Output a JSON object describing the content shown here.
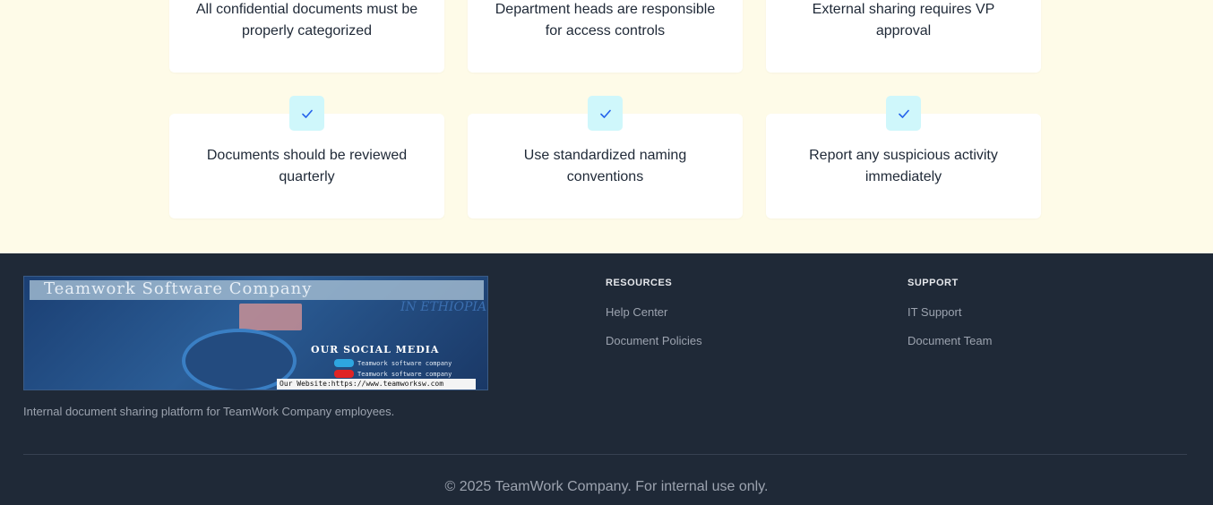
{
  "guidelines": {
    "row1": [
      {
        "text": "All confidential documents must be properly categorized"
      },
      {
        "text": "Department heads are responsible for access controls"
      },
      {
        "text": "External sharing requires VP approval"
      }
    ],
    "row2": [
      {
        "text": "Documents should be reviewed quarterly"
      },
      {
        "text": "Use standardized naming conventions"
      },
      {
        "text": "Report any suspicious activity immediately"
      }
    ],
    "check_icon": "check-icon"
  },
  "footer": {
    "logo": {
      "title": "Teamwork Software Company",
      "region": "IN ETHIOPIA",
      "social_heading": "OUR SOCIAL MEDIA",
      "telegram": "Teamwork software company",
      "youtube": "Teamwork software company",
      "website": "Our Website:https://www.teamworksw.com"
    },
    "tagline": "Internal document sharing platform for TeamWork Company employees.",
    "resources": {
      "title": "RESOURCES",
      "links": [
        "Help Center",
        "Document Policies"
      ]
    },
    "support": {
      "title": "SUPPORT",
      "links": [
        "IT Support",
        "Document Team"
      ]
    },
    "copyright": "© 2025 TeamWork Company. For internal use only."
  },
  "colors": {
    "section_bg": "#fefbe8",
    "card_bg": "#ffffff",
    "check_bg": "#cff7fb",
    "check_stroke": "#2563eb",
    "footer_bg": "#1f2937"
  }
}
